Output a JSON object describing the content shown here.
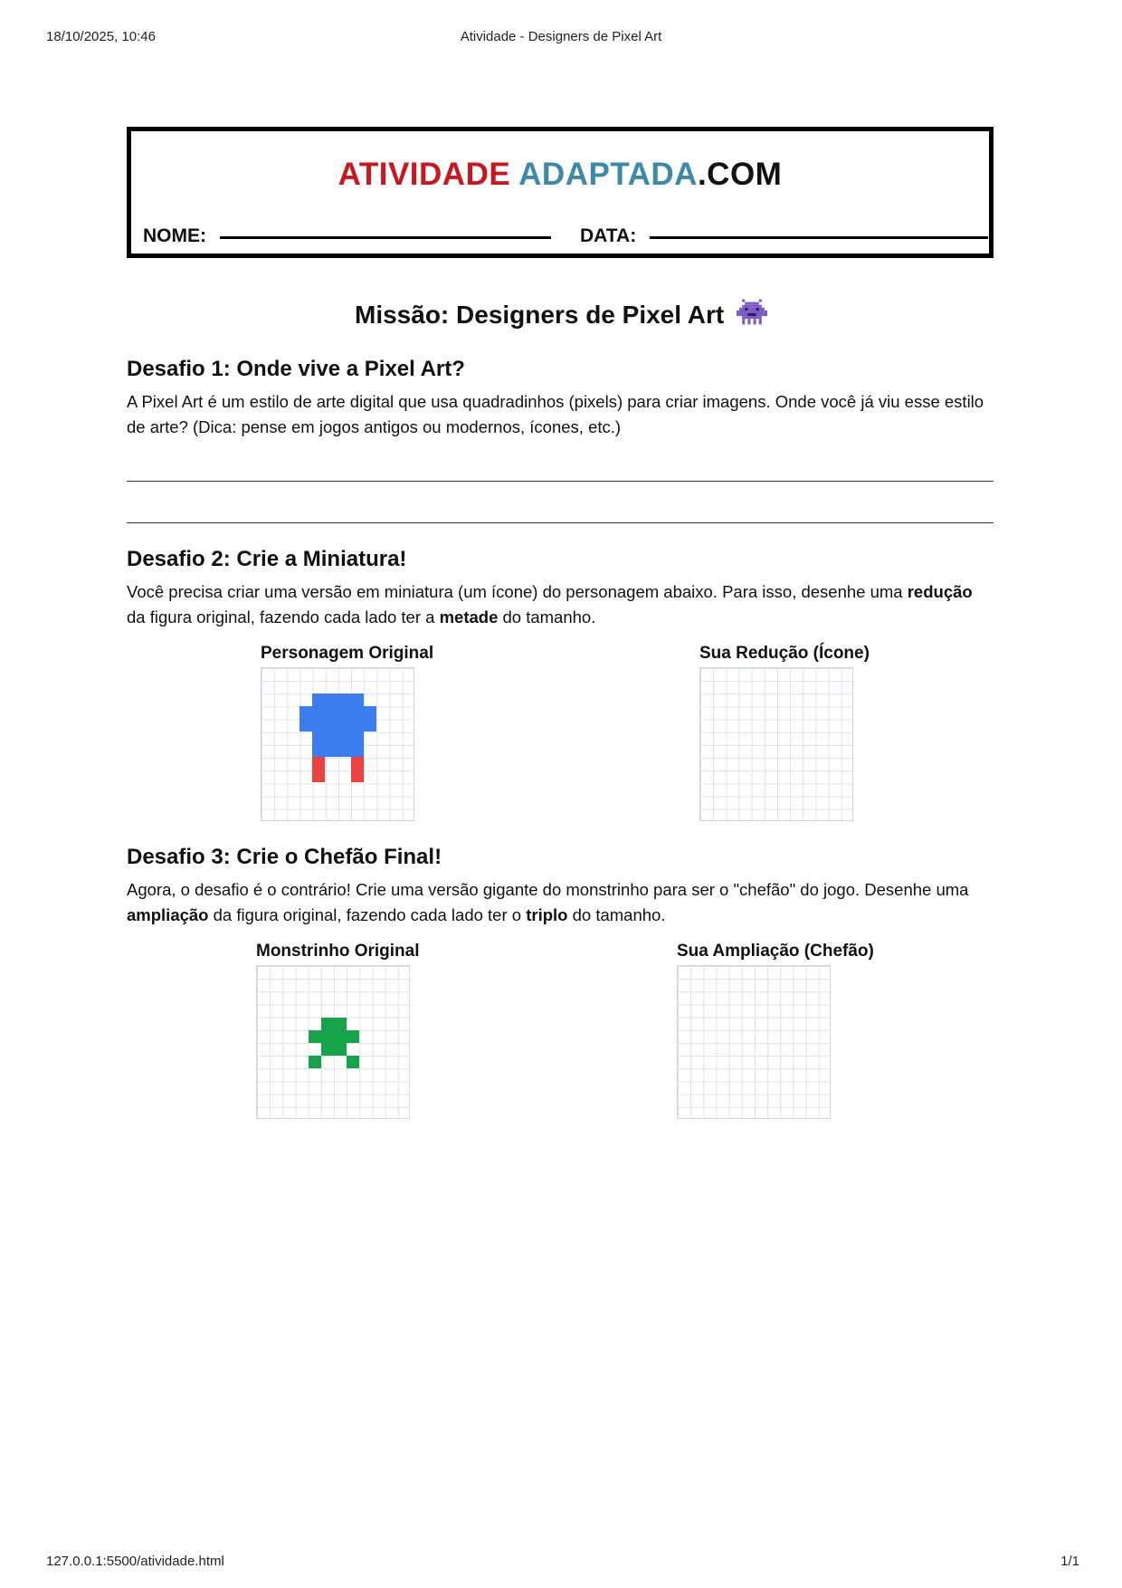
{
  "print_header": {
    "datetime": "18/10/2025, 10:46",
    "page_title": "Atividade - Designers de Pixel Art"
  },
  "brand": {
    "part1": "ATIVIDADE",
    "part2": "ADAPTADA",
    "part3": ".COM",
    "colors": {
      "part1": "#c8171e",
      "part2": "#3d8aa8",
      "part3": "#111111"
    }
  },
  "fields": {
    "name_label": "NOME:",
    "date_label": "DATA:"
  },
  "mission_title": "Missão: Designers de Pixel Art",
  "mission_icon": "pixel-monster-icon",
  "challenge1": {
    "title": "Desafio 1: Onde vive a Pixel Art?",
    "text": "A Pixel Art é um estilo de arte digital que usa quadradinhos (pixels) para criar imagens. Onde você já viu esse estilo de arte? (Dica: pense em jogos antigos ou modernos, ícones, etc.)"
  },
  "challenge2": {
    "title": "Desafio 2: Crie a Miniatura!",
    "text_a": "Você precisa criar uma versão em miniatura (um ícone) do personagem abaixo. Para isso, desenhe uma ",
    "bold_a": "redução",
    "text_b": " da figura original, fazendo cada lado ter a ",
    "bold_b": "metade",
    "text_c": " do tamanho.",
    "left_label": "Personagem Original",
    "right_label": "Sua Redução (Ícone)",
    "figure_colors": {
      "body": "#3b7ded",
      "legs": "#e74343"
    }
  },
  "challenge3": {
    "title": "Desafio 3: Crie o Chefão Final!",
    "text_a": "Agora, o desafio é o contrário! Crie uma versão gigante do monstrinho para ser o \"chefão\" do jogo. Desenhe uma ",
    "bold_a": "ampliação",
    "text_b": " da figura original, fazendo cada lado ter o ",
    "bold_b": "triplo",
    "text_c": " do tamanho.",
    "left_label": "Monstrinho Original",
    "right_label": "Sua Ampliação (Chefão)",
    "figure_colors": {
      "body": "#16a34a"
    }
  },
  "print_footer": {
    "url": "127.0.0.1:5500/atividade.html",
    "page": "1/1"
  }
}
